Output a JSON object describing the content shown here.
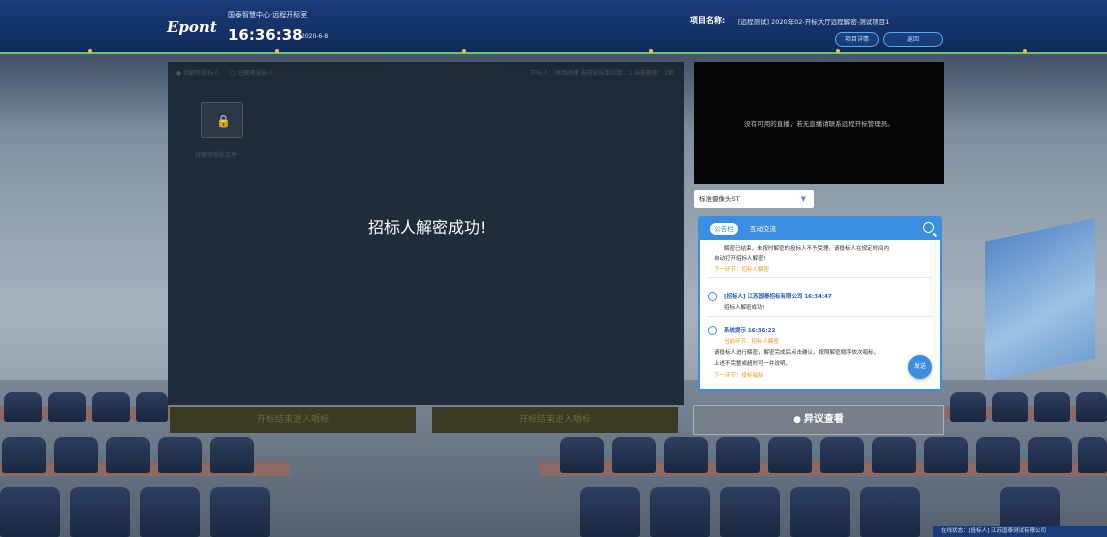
{
  "header": {
    "logo": "Epont",
    "hall_name": "国泰智慧中心·远程开标室",
    "time": "16:36:38",
    "date": "2020-6-8",
    "project_label": "项目名称:",
    "project_name": "[远程测试] 2020年02-开标大厅远程解密-测试项目1",
    "btn_project": "项目详情",
    "btn_back": "返回"
  },
  "main_panel": {
    "legend_1": "● 待解密投标人",
    "legend_2": "□ 已解密投标人",
    "top_right_text": "开标人：项目经理 当前投标单位数：1 当前解密：1家",
    "folder_label": "待解密投标文件",
    "decrypt_message": "招标人解密成功!",
    "btn_left": "开标结束进入唱标",
    "btn_right": "开标结束进入唱标"
  },
  "video": {
    "message": "没有可用的直播，若无直播请联系远程开标管理员。"
  },
  "select": {
    "value": "标准摄像头ST"
  },
  "chat": {
    "tab_active": "公告栏",
    "tab_other": "互动交流",
    "messages": [
      {
        "line1": "解密已结束，未按时解密的投标人不予受理。请投标人在规定时间内",
        "line2": "自动打开招标人解密!",
        "link": "下一环节：招标人解密"
      },
      {
        "sender": "[招标人] 江苏国泰招标有限公司 16:34:47",
        "text": "招标人解密成功!"
      },
      {
        "sender": "系统提示 16:36:22",
        "link_top": "当前环节：招标人解密",
        "line1": "请投标人进行解密，解密完成后点击确认，按照解密顺序依次唱标，",
        "line2": "上述不完整或超时可一并说明，",
        "link": "下一环节：投标唱标"
      }
    ],
    "fab_label": "发送"
  },
  "objection_button": {
    "label": "异议查看"
  },
  "footer": {
    "text": "在线状态：[投标人] 江苏国泰测试有限公司"
  }
}
